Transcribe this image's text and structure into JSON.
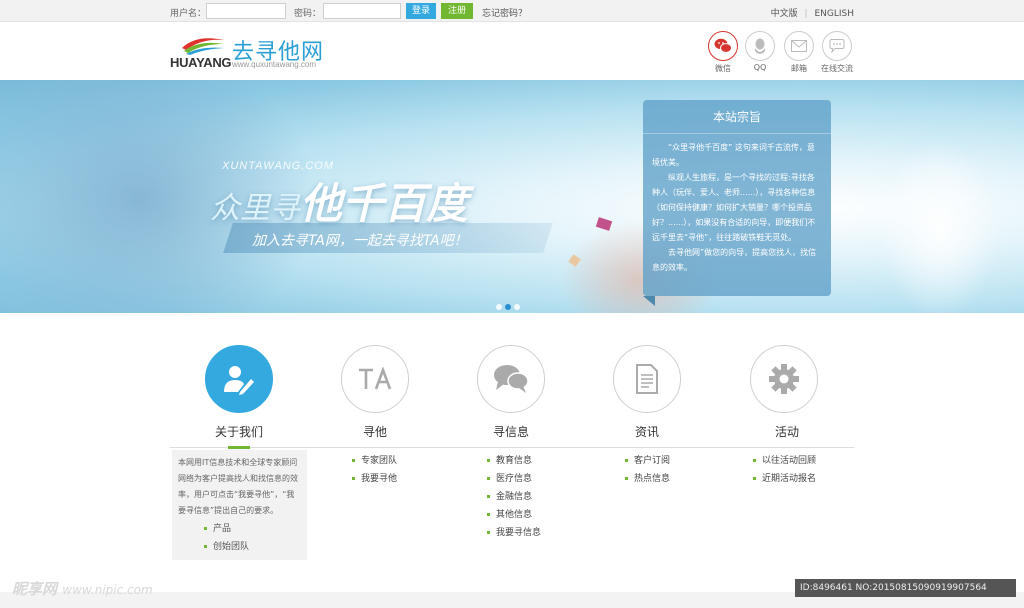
{
  "topbar": {
    "username_label": "用户名：",
    "password_label": "密码：",
    "login": "登录",
    "register": "注册",
    "forgot": "忘记密码？",
    "lang_cn": "中文版",
    "lang_sep": "|",
    "lang_en": "ENGLISH"
  },
  "header": {
    "brand_en": "HUAYANG",
    "brand_cn": "去寻他网",
    "brand_url": "www.quxuntawang.com",
    "social": [
      {
        "label": "微信",
        "icon": "wechat-icon"
      },
      {
        "label": "QQ",
        "icon": "qq-icon"
      },
      {
        "label": "邮箱",
        "icon": "mail-icon"
      },
      {
        "label": "在线交流",
        "icon": "chat-icon"
      }
    ]
  },
  "banner": {
    "sub_en": "XUNTAWANG.COM",
    "headline_small": "众里寻",
    "headline_big": "他千百度",
    "slogan": "加入去寻TA网，一起去寻找TA吧！",
    "slide_count": 3,
    "active_slide": 2,
    "mission": {
      "title": "本站宗旨",
      "paragraphs": [
        "“众里寻他千百度” 这句来词千古流传，意境优美。",
        "纵观人生旅程，是一个寻找的过程:寻找各种人（玩伴、爱人、老师......），寻找各种信息（如何保持健康？如何扩大销量？哪个投资品好？......），如果没有合适的向导，即便我们不远千里去“寻他”，往往踏破铁鞋无觅处。",
        "去寻他网”做您的向导，提高您找人，找信息的效率。"
      ]
    }
  },
  "categories": [
    {
      "label": "关于我们",
      "icon": "user-edit-icon",
      "active": true
    },
    {
      "label": "寻他",
      "icon": "ta-icon"
    },
    {
      "label": "寻信息",
      "icon": "chat-bubbles-icon"
    },
    {
      "label": "资讯",
      "icon": "document-icon"
    },
    {
      "label": "活动",
      "icon": "gear-icon"
    }
  ],
  "about": {
    "text": "本网用IT信息技术和全球专家顾问网络为客户提高找人和找信息的效率，用户可点击“我要寻他”，“我要寻信息”提出自己的要求。",
    "links": [
      "产品",
      "创始团队"
    ]
  },
  "columns": {
    "xunta": [
      "专家团队",
      "我要寻他"
    ],
    "xinxi": [
      "教育信息",
      "医疗信息",
      "金融信息",
      "其他信息",
      "我要寻信息"
    ],
    "zixun": [
      "客户订阅",
      "热点信息"
    ],
    "huodong": [
      "以往活动回顾",
      "近期活动报名"
    ]
  },
  "watermark": {
    "left": "昵享网",
    "left_url": "www.nipic.com",
    "right": "ID:8496461 NO:20150815090919907564"
  },
  "colors": {
    "accent_blue": "#33a9e0",
    "accent_green": "#72b731",
    "wechat_red": "#d6362f"
  }
}
